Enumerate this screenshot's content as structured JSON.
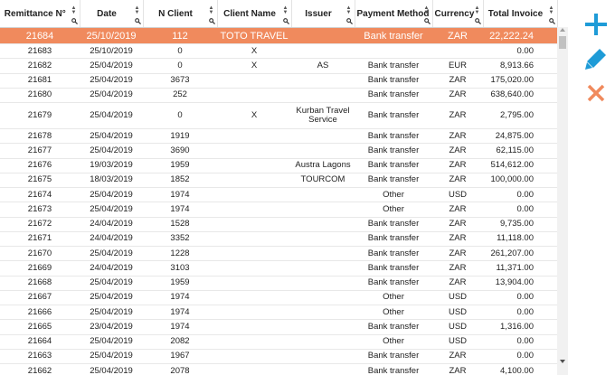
{
  "columns": [
    "Remittance N°",
    "Date",
    "N Client",
    "Client Name",
    "Issuer",
    "Payment Method",
    "Currency",
    "Total Invoice"
  ],
  "colors": {
    "selected_row": "#f08a5d",
    "add": "#1e9bd7",
    "edit": "#1e9bd7",
    "delete": "#f08a5d"
  },
  "icons": {
    "add": "plus-icon",
    "edit": "pencil-icon",
    "delete": "close-icon",
    "sort": "sort-arrows-icon",
    "filter": "search-icon"
  },
  "rows": [
    [
      "21684",
      "25/10/2019",
      "112",
      "TOTO TRAVEL",
      "",
      "Bank transfer",
      "ZAR",
      "22,222.24"
    ],
    [
      "21683",
      "25/10/2019",
      "0",
      "X",
      "",
      "",
      "",
      "0.00"
    ],
    [
      "21682",
      "25/04/2019",
      "0",
      "X",
      "AS",
      "Bank transfer",
      "EUR",
      "8,913.66"
    ],
    [
      "21681",
      "25/04/2019",
      "3673",
      "",
      "",
      "Bank transfer",
      "ZAR",
      "175,020.00"
    ],
    [
      "21680",
      "25/04/2019",
      "252",
      "",
      "",
      "Bank transfer",
      "ZAR",
      "638,640.00"
    ],
    [
      "21679",
      "25/04/2019",
      "0",
      "X",
      "Kurban Travel Service",
      "Bank transfer",
      "ZAR",
      "2,795.00"
    ],
    [
      "21678",
      "25/04/2019",
      "1919",
      "",
      "",
      "Bank transfer",
      "ZAR",
      "24,875.00"
    ],
    [
      "21677",
      "25/04/2019",
      "3690",
      "",
      "",
      "Bank transfer",
      "ZAR",
      "62,115.00"
    ],
    [
      "21676",
      "19/03/2019",
      "1959",
      "",
      "Austra Lagons",
      "Bank transfer",
      "ZAR",
      "514,612.00"
    ],
    [
      "21675",
      "18/03/2019",
      "1852",
      "",
      "TOURCOM",
      "Bank transfer",
      "ZAR",
      "100,000.00"
    ],
    [
      "21674",
      "25/04/2019",
      "1974",
      "",
      "",
      "Other",
      "USD",
      "0.00"
    ],
    [
      "21673",
      "25/04/2019",
      "1974",
      "",
      "",
      "Other",
      "ZAR",
      "0.00"
    ],
    [
      "21672",
      "24/04/2019",
      "1528",
      "",
      "",
      "Bank transfer",
      "ZAR",
      "9,735.00"
    ],
    [
      "21671",
      "24/04/2019",
      "3352",
      "",
      "",
      "Bank transfer",
      "ZAR",
      "11,118.00"
    ],
    [
      "21670",
      "25/04/2019",
      "1228",
      "",
      "",
      "Bank transfer",
      "ZAR",
      "261,207.00"
    ],
    [
      "21669",
      "24/04/2019",
      "3103",
      "",
      "",
      "Bank transfer",
      "ZAR",
      "11,371.00"
    ],
    [
      "21668",
      "25/04/2019",
      "1959",
      "",
      "",
      "Bank transfer",
      "ZAR",
      "13,904.00"
    ],
    [
      "21667",
      "25/04/2019",
      "1974",
      "",
      "",
      "Other",
      "USD",
      "0.00"
    ],
    [
      "21666",
      "25/04/2019",
      "1974",
      "",
      "",
      "Other",
      "USD",
      "0.00"
    ],
    [
      "21665",
      "23/04/2019",
      "1974",
      "",
      "",
      "Bank transfer",
      "USD",
      "1,316.00"
    ],
    [
      "21664",
      "25/04/2019",
      "2082",
      "",
      "",
      "Other",
      "USD",
      "0.00"
    ],
    [
      "21663",
      "25/04/2019",
      "1967",
      "",
      "",
      "Bank transfer",
      "ZAR",
      "0.00"
    ],
    [
      "21662",
      "25/04/2019",
      "2078",
      "",
      "",
      "Bank transfer",
      "ZAR",
      "4,100.00"
    ]
  ]
}
